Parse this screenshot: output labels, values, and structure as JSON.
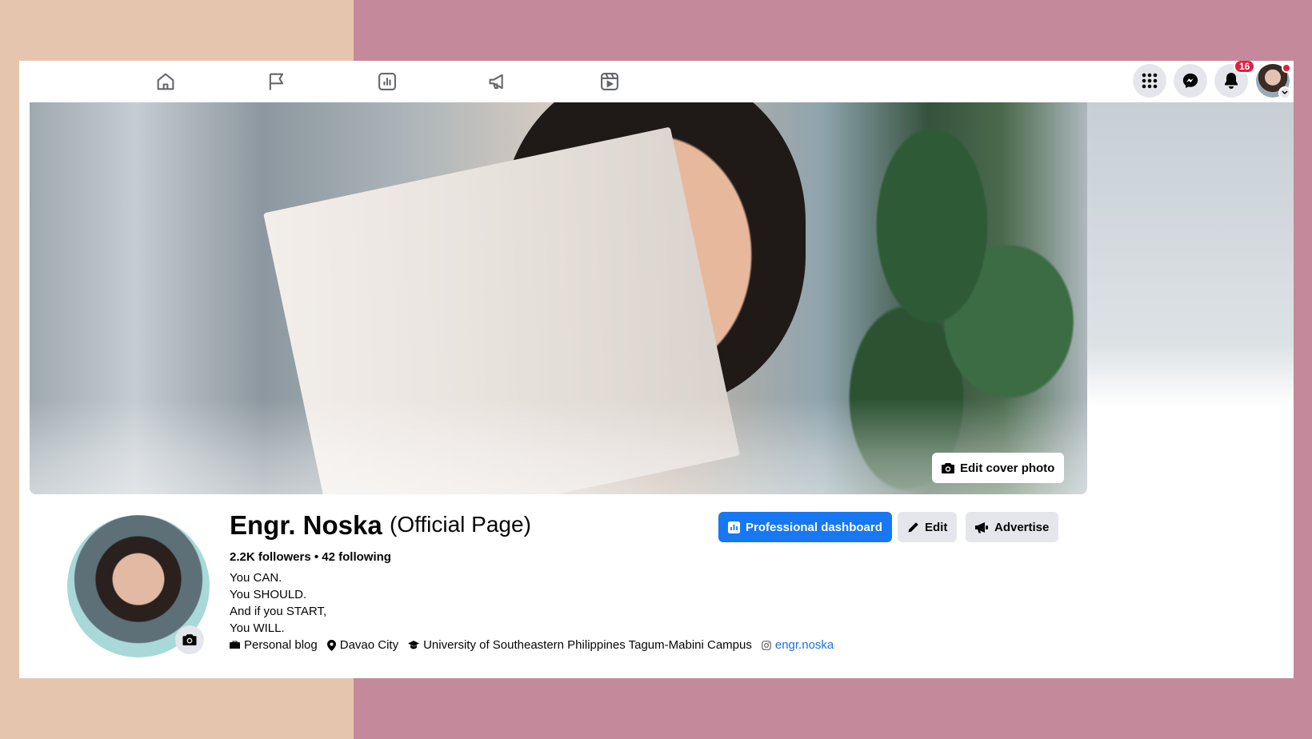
{
  "nav": {
    "tabs": [
      {
        "name": "home"
      },
      {
        "name": "flag"
      },
      {
        "name": "insights"
      },
      {
        "name": "megaphone"
      },
      {
        "name": "reels"
      }
    ],
    "notification_count": "16"
  },
  "cover": {
    "edit_label": "Edit cover photo"
  },
  "profile": {
    "name": "Engr. Noska",
    "suffix": "(Official Page)",
    "followers": "2.2K followers • 42 following",
    "bio": [
      "You CAN.",
      "You SHOULD.",
      "And if you START,",
      "You WILL."
    ],
    "meta": {
      "category": "Personal blog",
      "location": "Davao City",
      "school": "University of Southeastern Philippines Tagum-Mabini Campus",
      "instagram": "engr.noska"
    }
  },
  "actions": {
    "dashboard": "Professional dashboard",
    "edit": "Edit",
    "advertise": "Advertise"
  },
  "colors": {
    "accent": "#1877f2",
    "link": "#216fdb",
    "badge": "#e41e3f"
  }
}
